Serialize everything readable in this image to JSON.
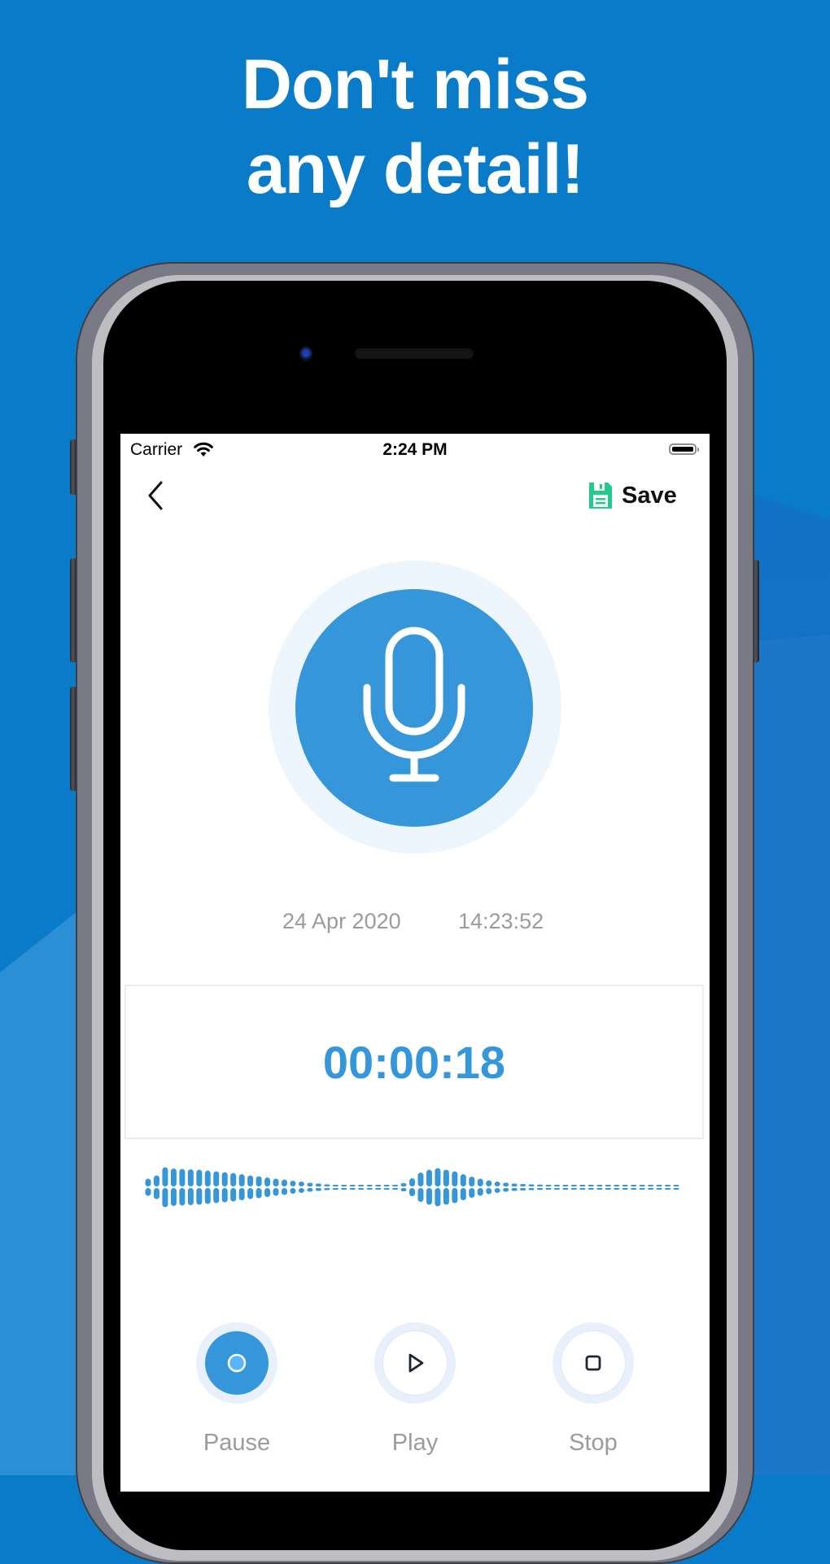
{
  "headline": {
    "line1": "Don't miss",
    "line2": "any detail!"
  },
  "status_bar": {
    "carrier": "Carrier",
    "time": "2:24 PM",
    "icons": [
      "wifi-icon",
      "battery-icon"
    ]
  },
  "nav": {
    "back_icon": "chevron-left-icon",
    "save_icon": "floppy-disk-icon",
    "save_label": "Save"
  },
  "recorder": {
    "mic_icon": "microphone-icon",
    "date": "24 Apr 2020",
    "time": "14:23:52",
    "elapsed": "00:00:18"
  },
  "waveform": {
    "description": "recorded audio amplitude bars (relative, 0-1)",
    "amplitudes": [
      0.42,
      0.58,
      0.98,
      0.92,
      0.9,
      0.88,
      0.86,
      0.82,
      0.78,
      0.74,
      0.7,
      0.64,
      0.58,
      0.54,
      0.48,
      0.42,
      0.38,
      0.32,
      0.28,
      0.22,
      0.18,
      0.14,
      0.12,
      0.1,
      0.1,
      0.1,
      0.1,
      0.1,
      0.1,
      0.12,
      0.2,
      0.44,
      0.72,
      0.86,
      0.94,
      0.86,
      0.78,
      0.64,
      0.52,
      0.42,
      0.34,
      0.28,
      0.22,
      0.18,
      0.16,
      0.14,
      0.13,
      0.12,
      0.12,
      0.12,
      0.11,
      0.11,
      0.11,
      0.1,
      0.1,
      0.1,
      0.1,
      0.1,
      0.1,
      0.1,
      0.1,
      0.1,
      0.1
    ],
    "color": "#3596da"
  },
  "controls": [
    {
      "label": "Pause",
      "icon": "record-dot-icon",
      "active": true
    },
    {
      "label": "Play",
      "icon": "play-icon",
      "active": false
    },
    {
      "label": "Stop",
      "icon": "stop-icon",
      "active": false
    }
  ],
  "colors": {
    "background": "#0a7bc8",
    "accent": "#3596da",
    "save_icon": "#1fcc8c",
    "muted_text": "#9b9b9b"
  }
}
